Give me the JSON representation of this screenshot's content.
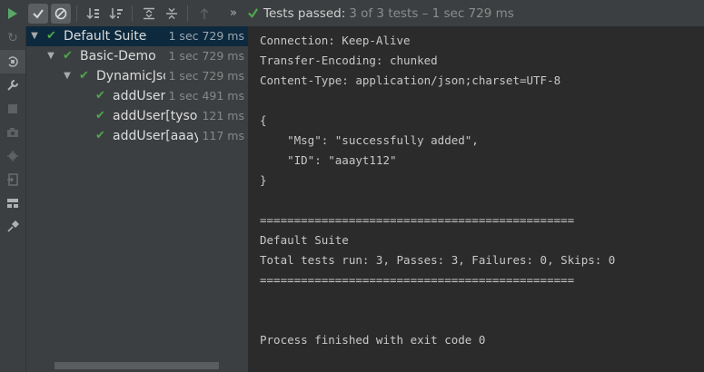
{
  "toolbar": {
    "run_icon": "play-icon",
    "status_passed": "Tests passed:",
    "status_rest": "3 of 3 tests – 1 sec 729 ms"
  },
  "tree": {
    "rows": [
      {
        "name": "Default Suite",
        "time": "1 sec 729 ms"
      },
      {
        "name": "Basic-Demo",
        "time": "1 sec 729 ms"
      },
      {
        "name": "DynamicJson",
        "time": "1 sec 729 ms"
      },
      {
        "name": "addUser[",
        "time": "1 sec 491 ms"
      },
      {
        "name": "addUser[tyso,",
        "time": "121 ms"
      },
      {
        "name": "addUser[aaayt",
        "time": "117 ms"
      }
    ]
  },
  "console": {
    "lines": [
      "Connection: Keep-Alive",
      "Transfer-Encoding: chunked",
      "Content-Type: application/json;charset=UTF-8",
      "",
      "{",
      "    \"Msg\": \"successfully added\",",
      "    \"ID\": \"aaayt112\"",
      "}",
      "",
      "==============================================",
      "Default Suite",
      "Total tests run: 3, Passes: 3, Failures: 0, Skips: 0",
      "==============================================",
      "",
      "",
      "Process finished with exit code 0"
    ]
  },
  "colors": {
    "pass": "#4ea64e",
    "run": "#59a869",
    "selection": "#0d293e"
  }
}
